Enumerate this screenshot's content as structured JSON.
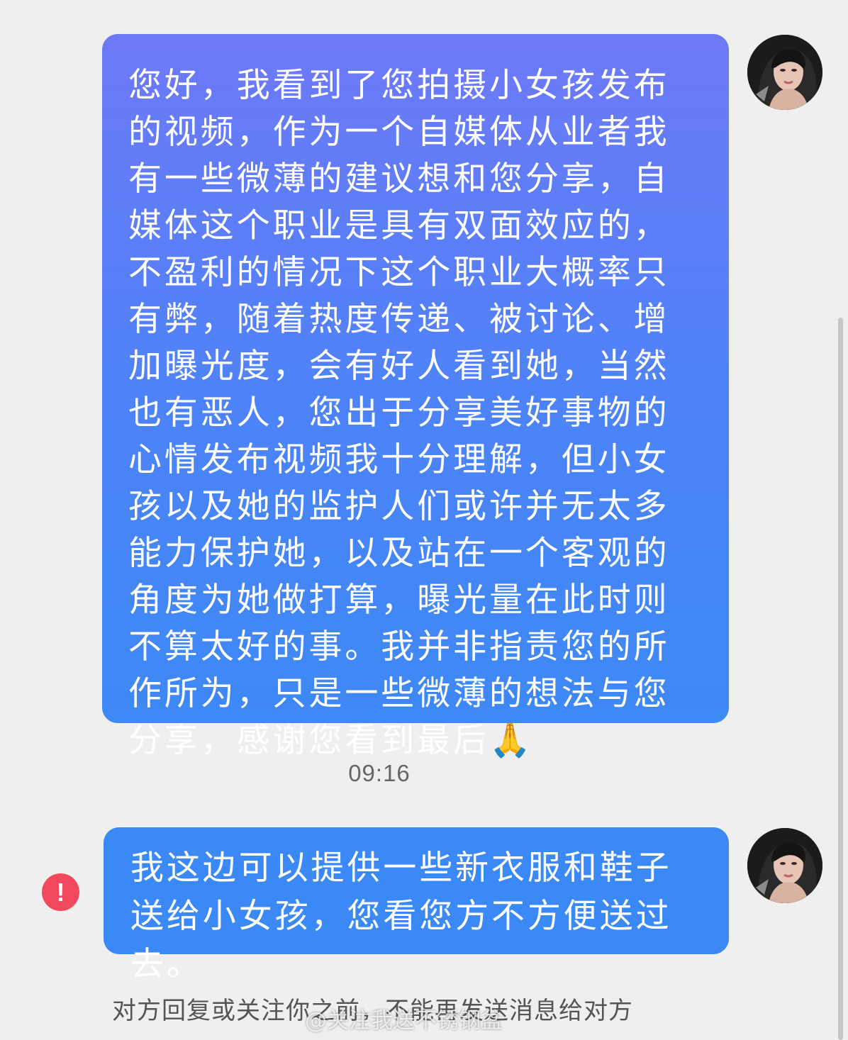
{
  "messages": [
    {
      "text": "您好，我看到了您拍摄小女孩发布的视频，作为一个自媒体从业者我有一些微薄的建议想和您分享，自媒体这个职业是具有双面效应的，不盈利的情况下这个职业大概率只有弊，随着热度传递、被讨论、增加曝光度，会有好人看到她，当然也有恶人，您出于分享美好事物的心情发布视频我十分理解，但小女孩以及她的监护人们或许并无太多能力保护她，以及站在一个客观的角度为她做打算，曝光量在此时则不算太好的事。我并非指责您的所作所为，只是一些微薄的想法与您分享，感谢您看到最后🙏",
      "status": "sent"
    },
    {
      "text": "我这边可以提供一些新衣服和鞋子送给小女孩，您看您方不方便送过去。",
      "status": "failed"
    }
  ],
  "timestamp": "09:16",
  "error_icon": "!",
  "notice": "对方回复或关注你之前，不能再发送消息给对方",
  "watermark": "@关注我送不锈钢盆",
  "colors": {
    "background": "#efefef",
    "bubble_gradient_top": "#6e79f8",
    "bubble_gradient_bottom": "#3d89f5",
    "bubble_solid": "#3a89f6",
    "error": "#f2475c"
  }
}
